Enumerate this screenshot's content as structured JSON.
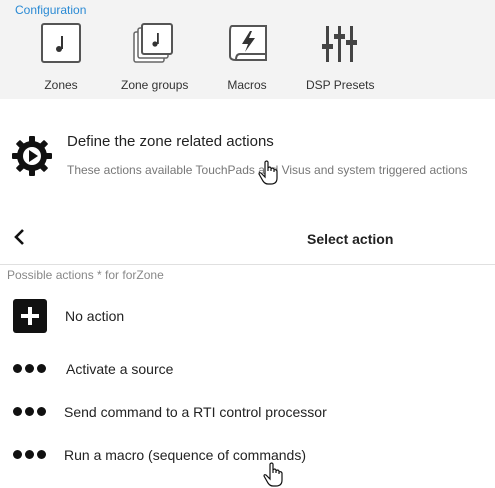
{
  "config": {
    "title": "Configuration",
    "tools": [
      {
        "label": "Zones",
        "icon": "music-note-icon"
      },
      {
        "label": "Zone groups",
        "icon": "music-stack-icon"
      },
      {
        "label": "Macros",
        "icon": "macro-scroll-icon"
      },
      {
        "label": "DSP Presets",
        "icon": "sliders-icon"
      }
    ]
  },
  "define": {
    "icon": "gear-play-icon",
    "title": "Define the zone related actions",
    "subtitle": "These actions available TouchPads and Visus and system triggered actions"
  },
  "select": {
    "back_icon": "chevron-left-icon",
    "title": "Select action"
  },
  "actions": {
    "header": "Possible actions * for forZone",
    "items": [
      {
        "label": "No action",
        "icon": "plus-square-icon"
      },
      {
        "label": "Activate a source",
        "icon": "more-dots-icon"
      },
      {
        "label": "Send command to a RTI control processor",
        "icon": "more-dots-icon"
      },
      {
        "label": "Run a macro (sequence of commands)",
        "icon": "more-dots-icon"
      }
    ]
  }
}
